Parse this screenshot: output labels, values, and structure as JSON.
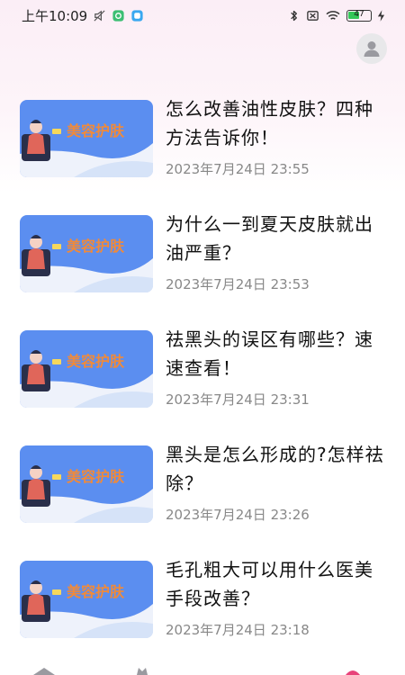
{
  "status_bar": {
    "time": "上午10:09",
    "battery": "47"
  },
  "icons": {
    "avatar": "user-avatar-icon",
    "thumbnail_banner": "美容护肤"
  },
  "articles": [
    {
      "title": "怎么改善油性皮肤？四种方法告诉你！",
      "date": "2023年7月24日 23:55"
    },
    {
      "title": "为什么一到夏天皮肤就出油严重？",
      "date": "2023年7月24日 23:53"
    },
    {
      "title": "祛黑头的误区有哪些？速速查看！",
      "date": "2023年7月24日 23:31"
    },
    {
      "title": "黑头是怎么形成的?怎样祛除？",
      "date": "2023年7月24日 23:26"
    },
    {
      "title": "毛孔粗大可以用什么医美手段改善？",
      "date": "2023年7月24日 23:18"
    }
  ],
  "colors": {
    "header_tint": "#fbeef6",
    "thumb_sky": "#5b8ef0",
    "banner_text": "#f08a3a"
  }
}
